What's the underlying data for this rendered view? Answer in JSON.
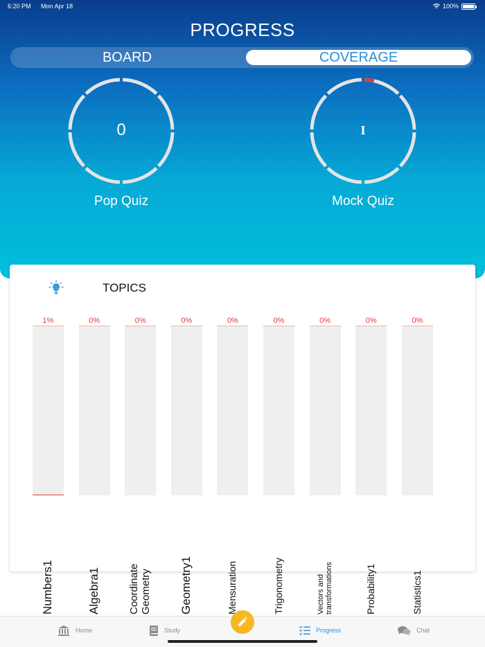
{
  "status_bar": {
    "time": "6:20 PM",
    "date": "Mon Apr 18",
    "battery": "100%"
  },
  "header": {
    "title": "PROGRESS"
  },
  "segments": {
    "board": "BOARD",
    "coverage": "COVERAGE",
    "selected": "coverage"
  },
  "quizzes": {
    "pop": {
      "label": "Pop Quiz",
      "value": "0",
      "progress": 0
    },
    "mock": {
      "label": "Mock Quiz",
      "value": "I",
      "progress": 0.03
    }
  },
  "topics": {
    "title": "TOPICS",
    "icon": "lightbulb-icon",
    "items": [
      {
        "name": "Numbers1",
        "pct_text": "1%",
        "value": 1
      },
      {
        "name": "Algebra1",
        "pct_text": "0%",
        "value": 0
      },
      {
        "name": "Coordinate Geometry",
        "pct_text": "0%",
        "value": 0
      },
      {
        "name": "Geometry1",
        "pct_text": "0%",
        "value": 0
      },
      {
        "name": "Mensuration",
        "pct_text": "0%",
        "value": 0
      },
      {
        "name": "Trigonometry",
        "pct_text": "0%",
        "value": 0
      },
      {
        "name": "Vectors and transformations",
        "pct_text": "0%",
        "value": 0
      },
      {
        "name": "Probability1",
        "pct_text": "0%",
        "value": 0
      },
      {
        "name": "Statistics1",
        "pct_text": "0%",
        "value": 0
      }
    ]
  },
  "tabbar": {
    "home": "Home",
    "study": "Study",
    "progress": "Progress",
    "chat": "Chat",
    "active": "progress"
  },
  "colors": {
    "accent": "#2a8fd8",
    "danger": "#e03a3a",
    "fab": "#f5b820"
  }
}
